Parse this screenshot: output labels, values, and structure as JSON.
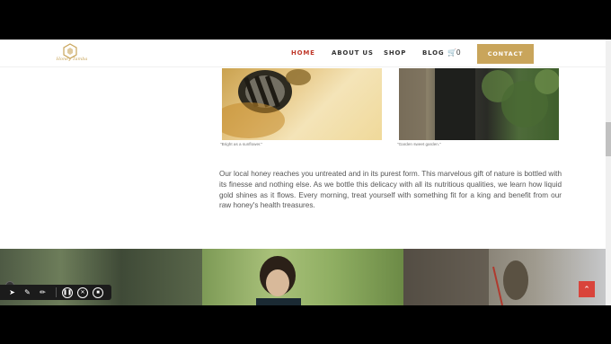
{
  "header": {
    "logo_text": "Honey Tamba",
    "nav": [
      {
        "label": "HOME",
        "active": true
      },
      {
        "label": "ABOUT US",
        "active": false
      },
      {
        "label": "SHOP",
        "active": false
      },
      {
        "label": "BLOG",
        "active": false
      }
    ],
    "cart_count": "0",
    "contact_label": "CONTACT"
  },
  "gallery": {
    "captions": [
      "\"Bright as a sunflower.\"",
      "\"Garden sweet garden.\""
    ]
  },
  "content": {
    "paragraph": "Our local honey reaches you untreated and in its purest form. This marvelous gift of nature is bottled with its finesse and nothing else. As we bottle this delicacy with all its nutritious qualities, we learn how liquid gold shines as it flows. Every morning, treat yourself with something fit for a king and benefit from our raw honey's health treasures."
  },
  "scroll_top_icon": "chevron-up-icon",
  "colors": {
    "accent_gold": "#c9a55b",
    "nav_active": "#c0392b",
    "scroll_top_bg": "#d9443b"
  },
  "toolbar": {
    "icons": [
      "cursor-icon",
      "pen-icon",
      "highlighter-icon",
      "pause-icon",
      "cancel-icon",
      "stop-icon"
    ]
  }
}
